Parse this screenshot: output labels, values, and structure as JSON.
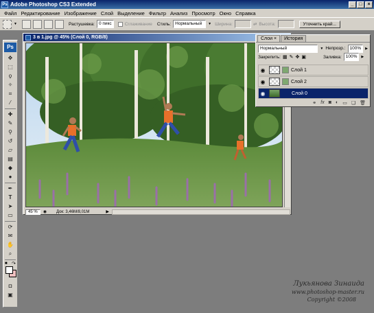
{
  "app": {
    "title": "Adobe Photoshop CS3 Extended",
    "logo": "Ps"
  },
  "menu": [
    "Файл",
    "Редактирование",
    "Изображение",
    "Слой",
    "Выделение",
    "Фильтр",
    "Анализ",
    "Просмотр",
    "Окно",
    "Справка"
  ],
  "options": {
    "feather_label": "Растушевка:",
    "feather_value": "0 пикс",
    "antialias_label": "Сглаживание",
    "style_label": "Стиль:",
    "style_value": "Нормальный",
    "width_label": "Ширина:",
    "height_label": "Высота:",
    "refine_label": "Уточнить край..."
  },
  "document": {
    "title": "3 в 1.jpg @ 45% (Слой 0, RGB/8)",
    "zoom": "45 %",
    "doc_info": "Док: 3,46M/8,01M"
  },
  "layers_panel": {
    "tabs": [
      "Слои",
      "История"
    ],
    "blend_mode": "Нормальный",
    "opacity_label": "Непрозр.:",
    "opacity_value": "100%",
    "lock_label": "Закрепить:",
    "fill_label": "Заливка:",
    "fill_value": "100%",
    "layers": [
      {
        "name": "Слой 1",
        "selected": false
      },
      {
        "name": "Слой 2",
        "selected": false
      },
      {
        "name": "Слой 0",
        "selected": true
      }
    ],
    "bottom_icons": [
      "link-icon",
      "fx-icon",
      "mask-icon",
      "adjustment-icon",
      "folder-icon",
      "new-layer-icon",
      "trash-icon"
    ]
  },
  "signature": {
    "line1": "Лукьянова Зинаида",
    "line2": "www.photoshop-master.ru",
    "line3": "Copyright ©2008"
  },
  "colors": {
    "titlebar": "#0a246a",
    "chrome": "#d4d0c8",
    "workspace": "#7d7d7d",
    "selection": "#0a246a",
    "background_swatch": "#f0c0c0"
  }
}
